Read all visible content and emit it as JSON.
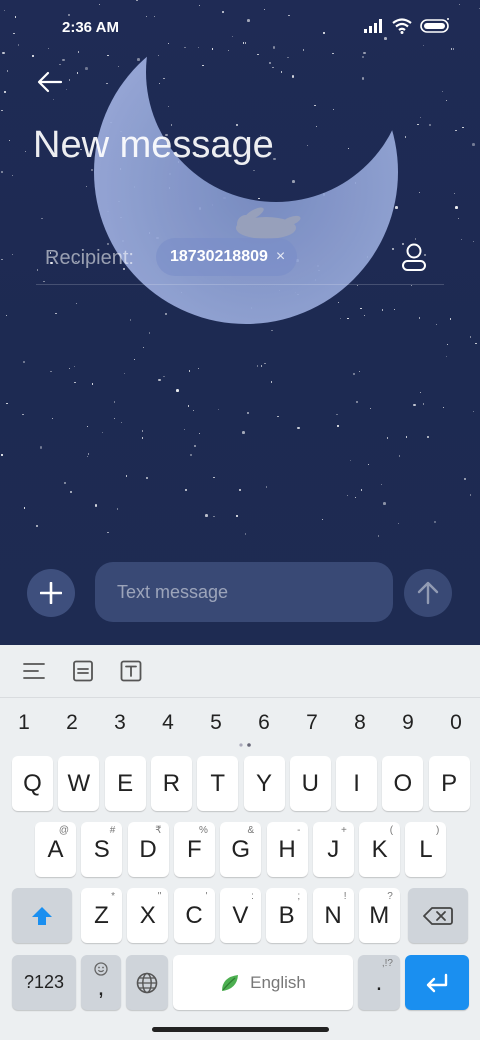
{
  "status_bar": {
    "time": "2:36 AM",
    "icons": [
      "signal-icon",
      "wifi-icon",
      "battery-icon"
    ]
  },
  "header": {
    "back_icon": "back-arrow-icon",
    "title": "New message"
  },
  "recipient": {
    "label": "Recipient:",
    "chip_value": "18730218809",
    "chip_remove": "×",
    "contact_picker_icon": "contact-icon"
  },
  "compose": {
    "attach_icon": "plus-icon",
    "placeholder": "Text message",
    "value": "",
    "send_icon": "send-arrow-icon"
  },
  "keyboard": {
    "toolbar_icons": [
      "menu-icon",
      "clipboard-icon",
      "text-edit-icon"
    ],
    "number_row": [
      "1",
      "2",
      "3",
      "4",
      "5",
      "6",
      "7",
      "8",
      "9",
      "0"
    ],
    "row1": [
      {
        "label": "Q",
        "hint": ""
      },
      {
        "label": "W",
        "hint": ""
      },
      {
        "label": "E",
        "hint": ""
      },
      {
        "label": "R",
        "hint": ""
      },
      {
        "label": "T",
        "hint": ""
      },
      {
        "label": "Y",
        "hint": ""
      },
      {
        "label": "U",
        "hint": ""
      },
      {
        "label": "I",
        "hint": ""
      },
      {
        "label": "O",
        "hint": ""
      },
      {
        "label": "P",
        "hint": ""
      }
    ],
    "row2": [
      {
        "label": "A",
        "hint": "@"
      },
      {
        "label": "S",
        "hint": "#"
      },
      {
        "label": "D",
        "hint": "₹"
      },
      {
        "label": "F",
        "hint": "%"
      },
      {
        "label": "G",
        "hint": "&"
      },
      {
        "label": "H",
        "hint": "-"
      },
      {
        "label": "J",
        "hint": "+"
      },
      {
        "label": "K",
        "hint": "("
      },
      {
        "label": "L",
        "hint": ")"
      }
    ],
    "row3": [
      {
        "label": "Z",
        "hint": "*"
      },
      {
        "label": "X",
        "hint": "\""
      },
      {
        "label": "C",
        "hint": "'"
      },
      {
        "label": "V",
        "hint": ":"
      },
      {
        "label": "B",
        "hint": ";"
      },
      {
        "label": "N",
        "hint": "!"
      },
      {
        "label": "M",
        "hint": "?"
      }
    ],
    "shift_icon": "shift-icon",
    "backspace_icon": "backspace-icon",
    "symbols_label": "?123",
    "comma_label": ",",
    "emoji_icon": "emoji-icon",
    "globe_icon": "globe-icon",
    "space_label": "English",
    "space_icon": "leaf-icon",
    "period_label": ".",
    "period_hint": ",!?",
    "enter_icon": "enter-icon",
    "accent_color": "#1a8ff0"
  }
}
